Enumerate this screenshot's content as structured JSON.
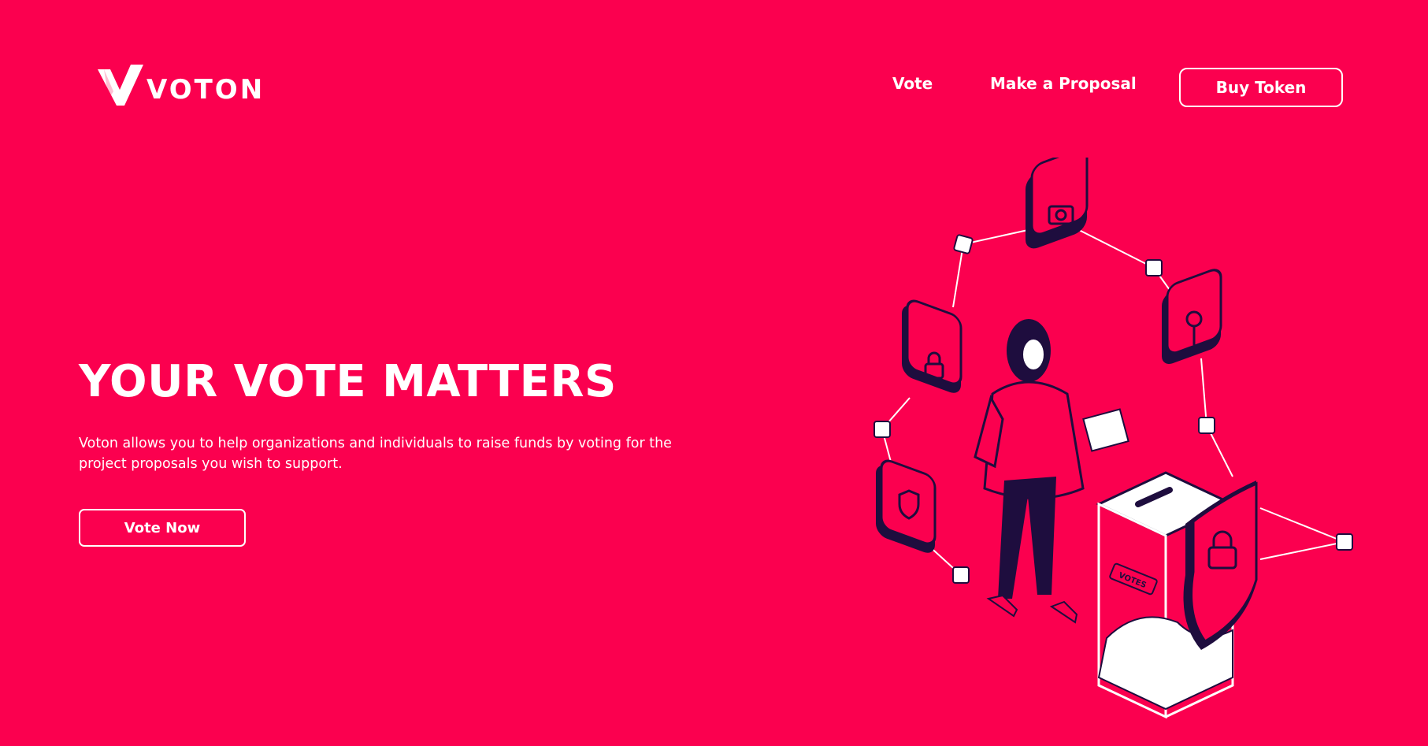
{
  "header": {
    "logo_text": "VOTON",
    "nav": {
      "vote_label": "Vote",
      "proposal_label": "Make a Proposal"
    },
    "buy_token_label": "Buy Token"
  },
  "hero": {
    "title": "YOUR VOTE MATTERS",
    "description": "Voton allows you to help organizations and individuals to raise funds by voting for the project proposals you wish to support.",
    "cta_label": "Vote Now"
  },
  "illustration": {
    "ballot_box_label": "VOTES",
    "icons": [
      "camera-icon",
      "key-icon",
      "lock-icon",
      "shield-icon",
      "padlock-shield-icon"
    ]
  },
  "colors": {
    "background": "#fb004f",
    "foreground": "#ffffff",
    "ink": "#1e0d3e"
  }
}
